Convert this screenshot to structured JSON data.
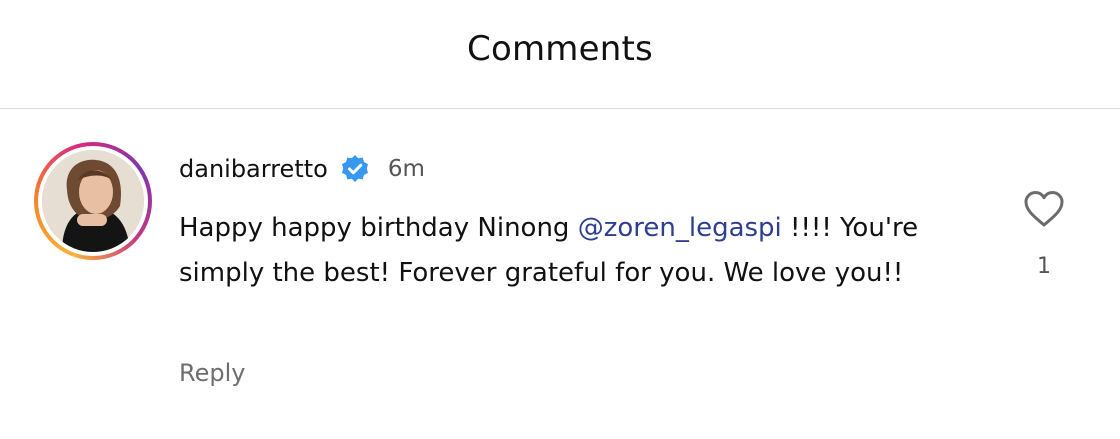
{
  "header": {
    "title": "Comments"
  },
  "comment": {
    "username": "danibarretto",
    "verified_icon": "verified-badge-icon",
    "time": "6m",
    "text_before": "Happy happy birthday Ninong ",
    "mention": "@zoren_legaspi",
    "text_after": " !!!! You're simply the best! Forever grateful for you. We love you!!",
    "reply_label": "Reply",
    "like_icon": "heart-outline-icon",
    "like_count": "1"
  },
  "colors": {
    "mention": "#2e3f8f",
    "verified": "#3897f0",
    "secondary_text": "#6e6e6e"
  }
}
